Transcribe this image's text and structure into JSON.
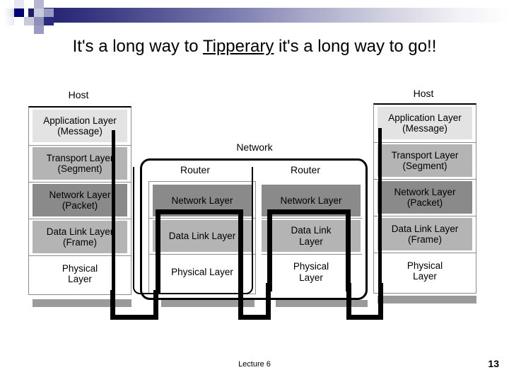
{
  "slide": {
    "title_before": "It's a long way to ",
    "title_underlined": "Tipperary",
    "title_after": " it's a long way to go!!",
    "footer_lecture": "Lecture 6",
    "footer_page": "13"
  },
  "colors": {
    "application_layer": "#e3e3e3",
    "transport_layer": "#b4b4b4",
    "network_layer": "#8a8a8a",
    "data_link_layer": "#b4b4b4",
    "physical_layer": "#ffffff",
    "medium_bar": "#9a9a9a",
    "connector": "#000000",
    "header_accent": "#00007a"
  },
  "diagram": {
    "left_host": {
      "caption": "Host",
      "layers": [
        {
          "name": "Application Layer",
          "unit": "(Message)"
        },
        {
          "name": "Transport Layer",
          "unit": "(Segment)"
        },
        {
          "name": "Network Layer",
          "unit": "(Packet)"
        },
        {
          "name": "Data Link Layer",
          "unit": "(Frame)"
        },
        {
          "name": "Physical",
          "unit": "Layer"
        }
      ]
    },
    "right_host": {
      "caption": "Host",
      "layers": [
        {
          "name": "Application Layer",
          "unit": "(Message)"
        },
        {
          "name": "Transport Layer",
          "unit": "(Segment)"
        },
        {
          "name": "Network Layer",
          "unit": "(Packet)"
        },
        {
          "name": "Data Link Layer",
          "unit": "(Frame)"
        },
        {
          "name": "Physical",
          "unit": "Layer"
        }
      ]
    },
    "network": {
      "caption": "Network",
      "routers": [
        {
          "caption": "Router",
          "layers": [
            {
              "name": "Network Layer",
              "unit": ""
            },
            {
              "name": "Data Link Layer",
              "unit": ""
            },
            {
              "name": "Physical Layer",
              "unit": ""
            }
          ]
        },
        {
          "caption": "Router",
          "layers": [
            {
              "name": "Network Layer",
              "unit": ""
            },
            {
              "name": "Data Link",
              "unit": "Layer"
            },
            {
              "name": "Physical",
              "unit": "Layer"
            }
          ]
        }
      ]
    }
  }
}
